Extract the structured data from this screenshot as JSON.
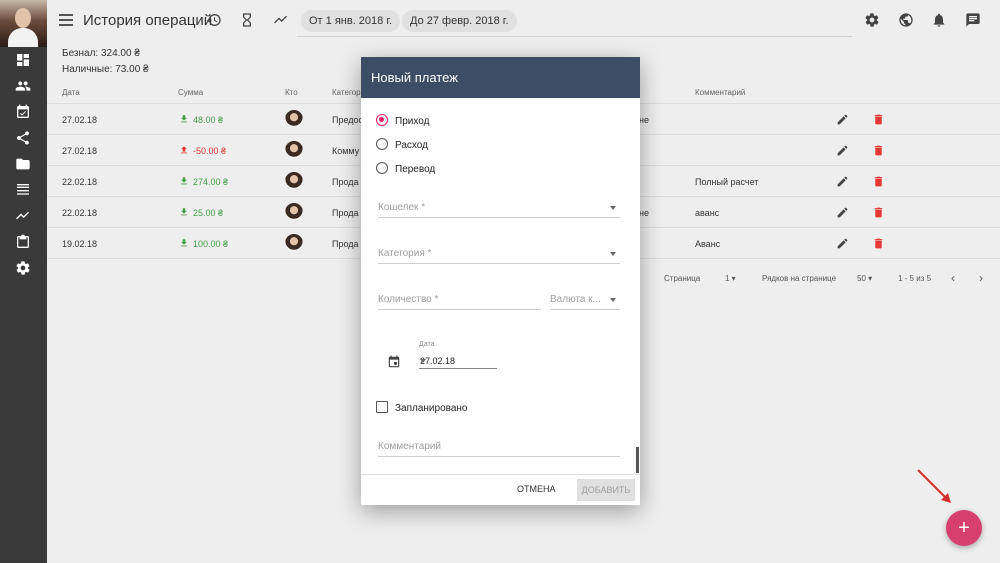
{
  "colors": {
    "accent": "#e91e63",
    "dialog_header": "#3d4d66",
    "income": "#43a047",
    "expense": "#e53935",
    "fab": "#d63f6f",
    "sidebar": "#3a3a3a"
  },
  "header": {
    "title": "История операций",
    "filter_from": "От 1 янв. 2018 г.",
    "filter_to": "До 27 февр. 2018 г."
  },
  "balance": {
    "cashless": "Безнал: 324.00 ₴",
    "cash": "Наличные: 73.00 ₴"
  },
  "table": {
    "headers": {
      "date": "Дата",
      "amount": "Сумма",
      "who": "Кто",
      "category": "Категор",
      "comment": "Комментарий"
    },
    "rows": [
      {
        "date": "27.02.18",
        "amount": "48.00 ₴",
        "type": "income",
        "category": "Предос",
        "extra": "не",
        "comment": ""
      },
      {
        "date": "27.02.18",
        "amount": "-50.00 ₴",
        "type": "expense",
        "category": "Комму",
        "extra": "",
        "comment": ""
      },
      {
        "date": "22.02.18",
        "amount": "274.00 ₴",
        "type": "income",
        "category": "Прода",
        "extra": "",
        "comment": "Полный расчет"
      },
      {
        "date": "22.02.18",
        "amount": "25.00 ₴",
        "type": "income",
        "category": "Прода",
        "extra": "не",
        "comment": "аванс"
      },
      {
        "date": "19.02.18",
        "amount": "100.00 ₴",
        "type": "income",
        "category": "Прода",
        "extra": "",
        "comment": "Аванс"
      }
    ]
  },
  "pager": {
    "page_label": "Страница",
    "page_value": "1",
    "rows_label": "Рядков на странице",
    "rows_value": "50",
    "range": "1 - 5 из 5"
  },
  "dialog": {
    "title": "Новый платеж",
    "radios": [
      {
        "label": "Приход",
        "checked": true
      },
      {
        "label": "Расход",
        "checked": false
      },
      {
        "label": "Перевод",
        "checked": false
      }
    ],
    "wallet_label": "Кошелек *",
    "category_label": "Категория *",
    "quantity_label": "Количество *",
    "currency_label": "Валюта к...",
    "date_label": "Дата",
    "date_value": "27.02.18",
    "scheduled_label": "Запланировано",
    "comment_placeholder": "Комментарий",
    "cancel_label": "ОТМЕНА",
    "add_label": "ДОБАВИТЬ"
  },
  "fab": {
    "label": "+"
  }
}
